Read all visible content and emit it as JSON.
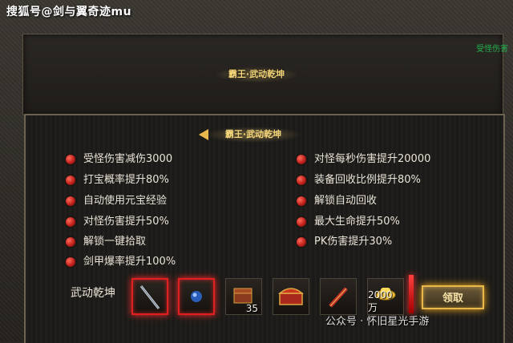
{
  "watermark_top": "搜狐号@剑与翼奇迹mu",
  "corner_text": "受怪伤害",
  "top_title": "霸王·武动乾坤",
  "section_title": "霸王·武动乾坤",
  "features_left": [
    "受怪伤害减伤3000",
    "打宝概率提升80%",
    "自动使用元宝经验",
    "对怪伤害提升50%",
    "解锁一键拾取",
    "剑甲爆率提升100%"
  ],
  "features_right": [
    "对怪每秒伤害提升20000",
    "装备回收比例提升80%",
    "解锁自动回收",
    "最大生命提升50%",
    "PK伤害提升30%"
  ],
  "reward_label": "武动乾坤",
  "reward_slots": [
    {
      "icon": "sword-icon",
      "count": "",
      "highlight": true
    },
    {
      "icon": "orb-icon",
      "count": "",
      "highlight": true
    },
    {
      "icon": "treasure-box-icon",
      "count": "35",
      "highlight": false
    },
    {
      "icon": "chest-icon",
      "count": "",
      "highlight": false
    },
    {
      "icon": "firecracker-icon",
      "count": "",
      "highlight": false
    },
    {
      "icon": "gold-ingot-icon",
      "count": "2000万",
      "highlight": false
    }
  ],
  "claim_button": "领取",
  "watermark_bottom": "公众号 · 怀旧星光手游",
  "colors": {
    "accent_gold": "#e8b84a",
    "highlight_red": "#e02020",
    "green_text": "#22b14c"
  }
}
